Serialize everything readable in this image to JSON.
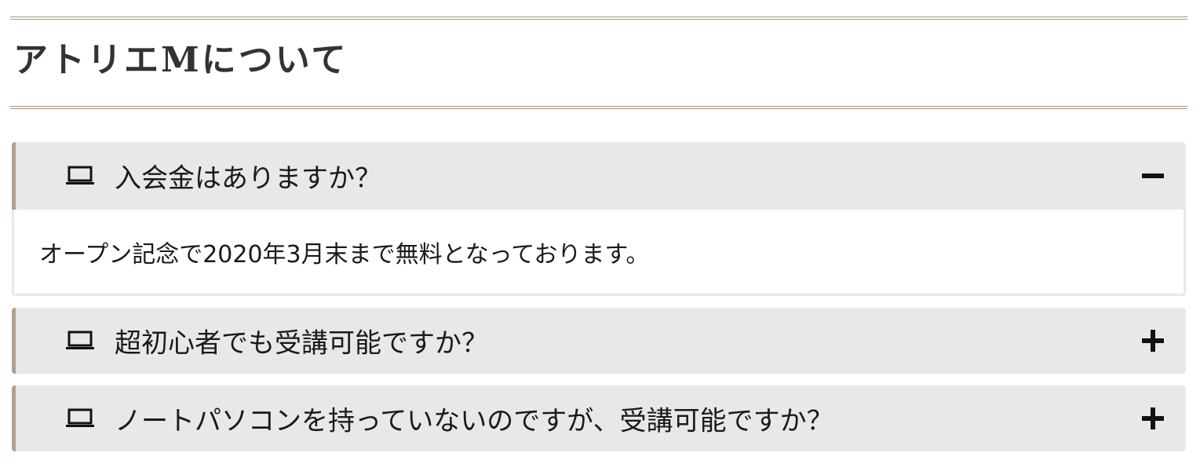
{
  "section": {
    "title": "アトリエMについて"
  },
  "faq": {
    "items": [
      {
        "question": "入会金はありますか？",
        "answer": "オープン記念で2020年3月末まで無料となっております。",
        "expanded": true
      },
      {
        "question": "超初心者でも受講可能ですか？",
        "expanded": false
      },
      {
        "question": "ノートパソコンを持っていないのですが、受講可能ですか？",
        "expanded": false
      }
    ]
  },
  "icons": {
    "question_icon": "laptop-icon",
    "expanded_toggle": "minus-icon",
    "collapsed_toggle": "plus-icon"
  },
  "colors": {
    "accent": "#b29f8c",
    "heading_rule": "#a89482",
    "question_bg": "#e8e8e8",
    "heading_text": "#333333"
  }
}
